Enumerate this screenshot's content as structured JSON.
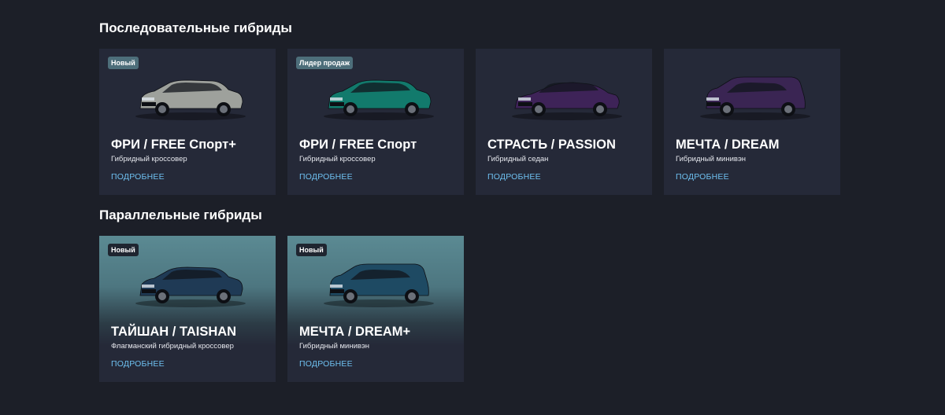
{
  "sections": [
    {
      "title": "Последовательные гибриды",
      "cards": [
        {
          "badge": "Новый",
          "title": "ФРИ / FREE Спорт+",
          "subtitle": "Гибридный кроссовер",
          "link": "ПОДРОБНЕЕ",
          "car_color": "#9ea19c",
          "car_type": "suv"
        },
        {
          "badge": "Лидер продаж",
          "title": "ФРИ / FREE Спорт",
          "subtitle": "Гибридный кроссовер",
          "link": "ПОДРОБНЕЕ",
          "car_color": "#127a6c",
          "car_type": "suv"
        },
        {
          "badge": "",
          "title": "СТРАСТЬ / PASSION",
          "subtitle": "Гибридный седан",
          "link": "ПОДРОБНЕЕ",
          "car_color": "#3e2358",
          "car_type": "sedan"
        },
        {
          "badge": "",
          "title": "МЕЧТА / DREAM",
          "subtitle": "Гибридный минивэн",
          "link": "ПОДРОБНЕЕ",
          "car_color": "#3a2553",
          "car_type": "van"
        }
      ]
    },
    {
      "title": "Параллельные гибриды",
      "cards": [
        {
          "badge": "Новый",
          "title": "ТАЙШАН / TAISHAN",
          "subtitle": "Флагманский гибридный кроссовер",
          "link": "ПОДРОБНЕЕ",
          "car_color": "#1f3a55",
          "car_type": "suv"
        },
        {
          "badge": "Новый",
          "title": "МЕЧТА / DREAM+",
          "subtitle": "Гибридный минивэн",
          "link": "ПОДРОБНЕЕ",
          "car_color": "#1e4a63",
          "car_type": "van"
        }
      ]
    }
  ]
}
